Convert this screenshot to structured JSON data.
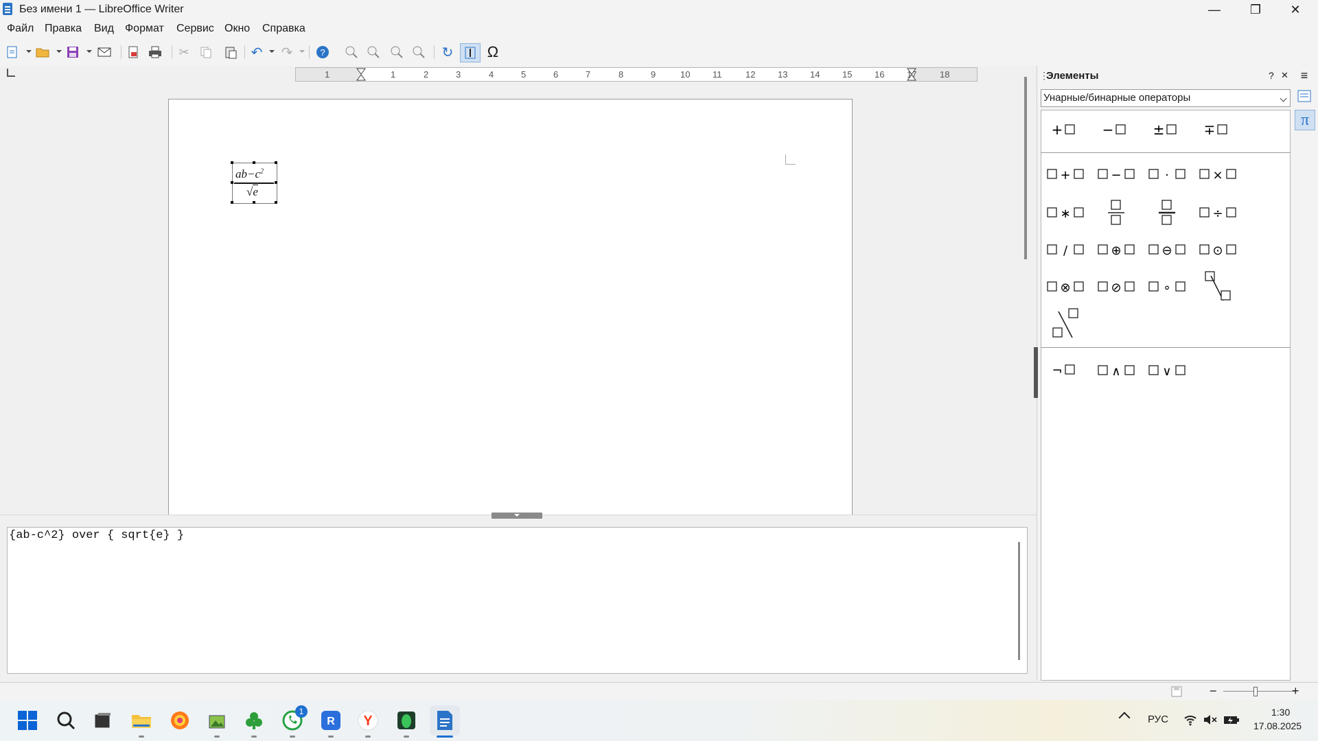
{
  "window": {
    "title": "Без имени 1 — LibreOffice Writer",
    "minimize": "—",
    "restore": "❐",
    "close": "✕"
  },
  "menu": [
    "Файл",
    "Правка",
    "Вид",
    "Формат",
    "Сервис",
    "Окно",
    "Справка"
  ],
  "ruler": {
    "labels": [
      "1",
      "1",
      "2",
      "3",
      "4",
      "5",
      "6",
      "7",
      "8",
      "9",
      "10",
      "11",
      "12",
      "13",
      "14",
      "15",
      "16",
      "17",
      "18"
    ]
  },
  "formula": {
    "numerator": "ab−c",
    "exponent": "2",
    "denominator": "e",
    "command": "{ab-c^2} over { sqrt{e} }"
  },
  "sidebar": {
    "title": "Элементы",
    "help": "?",
    "close": "✕",
    "menu": "≡",
    "category": "Унарные/бинарные операторы",
    "unary": [
      {
        "name": "plus",
        "text": "+"
      },
      {
        "name": "minus",
        "text": "−"
      },
      {
        "name": "plus-minus",
        "text": "±"
      },
      {
        "name": "minus-plus",
        "text": "∓"
      }
    ],
    "binary": [
      {
        "name": "add",
        "text": "+"
      },
      {
        "name": "subtract",
        "text": "−"
      },
      {
        "name": "dot",
        "text": "·"
      },
      {
        "name": "times",
        "text": "×"
      },
      {
        "name": "asterisk",
        "text": "∗"
      },
      {
        "name": "divide",
        "text": "÷"
      },
      {
        "name": "slash",
        "text": "/"
      },
      {
        "name": "circled-plus",
        "text": "⊕"
      },
      {
        "name": "circled-minus",
        "text": "⊖"
      },
      {
        "name": "circled-dot",
        "text": "⊙"
      },
      {
        "name": "circled-times",
        "text": "⊗"
      },
      {
        "name": "circled-slash",
        "text": "⊘"
      },
      {
        "name": "ring",
        "text": "∘"
      }
    ],
    "logic": [
      {
        "name": "not",
        "text": "¬"
      },
      {
        "name": "and",
        "text": "∧"
      },
      {
        "name": "or",
        "text": "∨"
      }
    ]
  },
  "statusbar": {
    "zoom_minus": "−",
    "zoom_plus": "+"
  },
  "taskbar": {
    "lang": "РУС",
    "time": "1:30",
    "date": "17.08.2025",
    "whatsapp_badge": "1"
  },
  "colors": {
    "accent": "#2b74c7",
    "panel": "#f3f3f3",
    "selection_border": "#777777"
  }
}
